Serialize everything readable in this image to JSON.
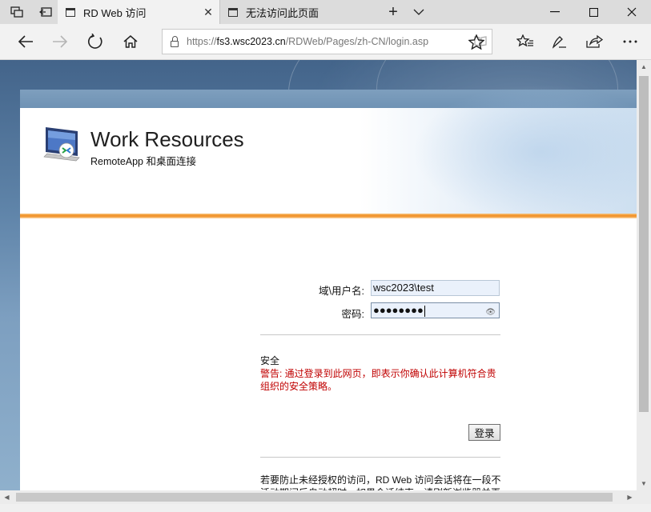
{
  "browser": {
    "tabs": [
      {
        "title": "RD Web 访问",
        "active": true
      },
      {
        "title": "无法访问此页面",
        "active": false
      }
    ],
    "new_tab_label": "+",
    "tab_list_label": "∨",
    "window_controls": {
      "minimize": "—",
      "maximize": "☐",
      "close": "✕"
    },
    "address": {
      "scheme": "https://",
      "host": "fs3.wsc2023.cn",
      "path": "/RDWeb/Pages/zh-CN/login.asp"
    },
    "icons": [
      "tab-manager-icon",
      "set-tabs-aside-icon",
      "back-icon",
      "forward-icon",
      "refresh-icon",
      "home-icon",
      "lock-icon",
      "reading-view-icon",
      "favorite-star-icon",
      "favorites-hub-icon",
      "pen-icon",
      "share-icon",
      "more-icon"
    ]
  },
  "page": {
    "title": "Work Resources",
    "subtitle": "RemoteApp 和桌面连接",
    "username_label": "域\\用户名:",
    "username_value": "wsc2023\\test",
    "password_label": "密码:",
    "password_mask": "●●●●●●●●",
    "security_title": "安全",
    "security_warning": "警告: 通过登录到此网页，即表示你确认此计算机符合贵组织的安全策略。",
    "login_button": "登录",
    "timeout_note": "若要防止未经授权的访问，RD Web 访问会话将在一段不活动期间后自动超时。如果会话结束，请刷新浏览器并再次登录。"
  },
  "colors": {
    "accent_orange": "#f08a1c",
    "warning_red": "#c00000",
    "banner_blue": "#6f92b4"
  }
}
